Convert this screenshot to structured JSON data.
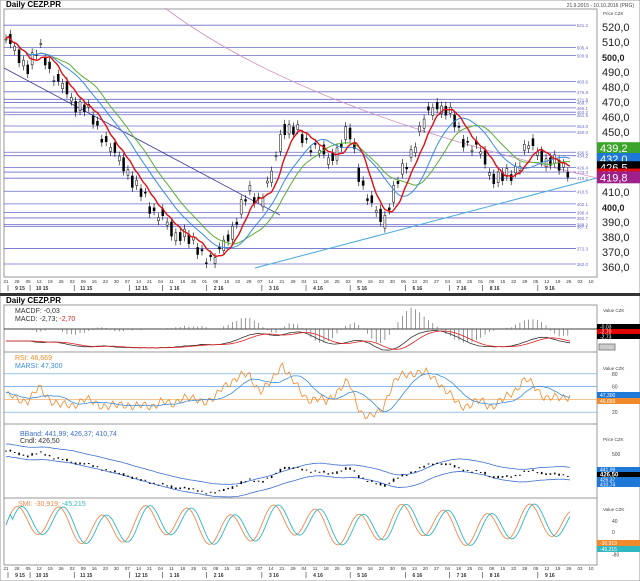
{
  "header": {
    "title": "Daily CEZP.PR",
    "range": "21.9.2015 - 10.10.2016 (PRG)",
    "axis_unit": "Price\nCZK"
  },
  "lower_header": {
    "title": "Daily CEZP.PR"
  },
  "chart_data": [
    {
      "type": "candlestick",
      "title": "Daily CEZP.PR",
      "ylabel": "Price CZK",
      "ylim": [
        358,
        524
      ],
      "yticks": [
        "520,0",
        "510,0",
        "500,0",
        "490,0",
        "480,0",
        "470,0",
        "460,0",
        "450,0",
        "440,0",
        "430,0",
        "420,0",
        "410,0",
        "400,0",
        "390,0",
        "380,0",
        "370,0",
        "360,0"
      ],
      "close_keypoints": [
        512,
        500,
        495,
        505,
        492,
        480,
        470,
        468,
        455,
        445,
        432,
        425,
        410,
        400,
        395,
        380,
        385,
        372,
        368,
        365,
        380,
        395,
        410,
        405,
        420,
        455,
        450,
        445,
        440,
        430,
        440,
        450,
        420,
        400,
        390,
        410,
        425,
        445,
        460,
        470,
        462,
        450,
        440,
        435,
        420,
        418,
        425,
        440,
        438,
        430,
        427,
        426.5
      ],
      "levels": [
        521.2,
        506.4,
        500.9,
        483.6,
        476.8,
        471.8,
        469.7,
        466.1,
        463.2,
        461.5,
        454.0,
        450.0,
        436.5,
        434.2,
        426.4,
        423.3,
        419.2,
        410.5,
        402.1,
        396.4,
        392.7,
        388.2,
        387.1,
        372.3,
        362.0
      ],
      "badges": [
        {
          "value": "439,2",
          "color": "#3aa52a"
        },
        {
          "value": "432,0",
          "color": "#1e78d8"
        },
        {
          "value": "426,5",
          "color": "#000000"
        },
        {
          "value": "426,4",
          "color": "#e01010"
        },
        {
          "value": "419,8",
          "color": "#a0208a"
        }
      ]
    },
    {
      "type": "line",
      "name": "MACD",
      "labels": [
        "MACDF: -0,03",
        "MACD: -2,73; ",
        "-2,70"
      ],
      "badges": [
        "-0,03",
        "-2,70",
        "-2,73"
      ],
      "axis_unit": "Value\nCZK"
    },
    {
      "type": "line",
      "name": "RSI",
      "labels": [
        "RSI: 46,669",
        "MARSI: 47,300"
      ],
      "yticks": [
        "80",
        "60",
        "40",
        "20"
      ],
      "badges": [
        "47,300",
        "46,669"
      ],
      "axis_unit": "Value\nCZK"
    },
    {
      "type": "line",
      "name": "BBand",
      "labels": [
        "BBand: 441,99; 426,37; 410,74",
        "Cndl: 426,50"
      ],
      "yticks": [
        "500"
      ],
      "badges": [
        "441,99",
        "426,50",
        "426,37",
        "410,74"
      ],
      "axis_unit": "Price\nCZK"
    },
    {
      "type": "line",
      "name": "SMI",
      "labels": [
        "SMI: -30,919; ",
        "-45,215"
      ],
      "yticks": [
        "40",
        "0",
        "-40",
        "-80"
      ],
      "badges": [
        "-30,919",
        "-45,215"
      ],
      "axis_unit": "Value\nCZK"
    }
  ],
  "x_axis": {
    "days": [
      "21",
      "28",
      "05",
      "12",
      "19",
      "26",
      "02",
      "09",
      "16",
      "23",
      "30",
      "07",
      "14",
      "21",
      "04",
      "11",
      "18",
      "25",
      "01",
      "08",
      "15",
      "22",
      "29",
      "07",
      "14",
      "21",
      "29",
      "04",
      "11",
      "18",
      "25",
      "02",
      "09",
      "16",
      "23",
      "30",
      "06",
      "13",
      "20",
      "27",
      "04",
      "18",
      "25",
      "01",
      "08",
      "15",
      "22",
      "29",
      "05",
      "12",
      "19",
      "26",
      "03",
      "10"
    ],
    "months": [
      {
        "label": "9 15",
        "at": 0
      },
      {
        "label": "10 15",
        "at": 2
      },
      {
        "label": "11 15",
        "at": 6
      },
      {
        "label": "12 15",
        "at": 11
      },
      {
        "label": "1 16",
        "at": 14
      },
      {
        "label": "2 16",
        "at": 18
      },
      {
        "label": "3 16",
        "at": 23
      },
      {
        "label": "4 16",
        "at": 27
      },
      {
        "label": "5 16",
        "at": 31
      },
      {
        "label": "6 16",
        "at": 36
      },
      {
        "label": "7 16",
        "at": 40
      },
      {
        "label": "8 16",
        "at": 43
      },
      {
        "label": "9 16",
        "at": 48
      }
    ]
  },
  "auto_label": "Auto",
  "colors": {
    "level": "#6b6bc8",
    "ma_red": "#e01010",
    "ma_blue": "#3a8de0",
    "ma_green": "#5ab030",
    "rsi": "#f08a2a",
    "marsi": "#3a8de0",
    "smi1": "#f08a50",
    "smi2": "#30b8c0"
  }
}
